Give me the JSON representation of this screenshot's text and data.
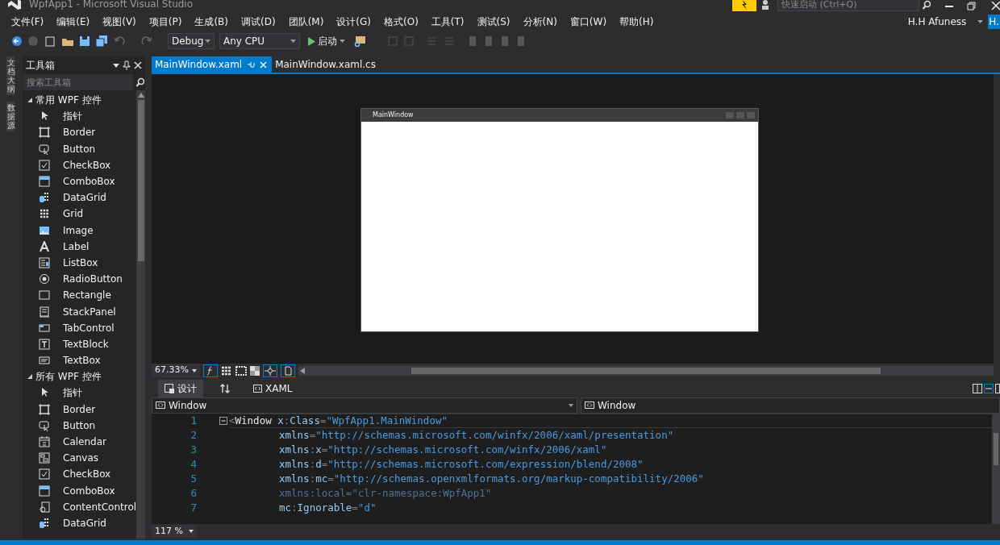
{
  "window": {
    "title": "WpfApp1 - Microsoft Visual Studio",
    "quick_launch": {
      "placeholder": "快速启动 (Ctrl+Q)"
    }
  },
  "menu": [
    "文件(F)",
    "编辑(E)",
    "视图(V)",
    "项目(P)",
    "生成(B)",
    "调试(D)",
    "团队(M)",
    "设计(G)",
    "格式(O)",
    "工具(T)",
    "测试(S)",
    "分析(N)",
    "窗口(W)",
    "帮助(H)"
  ],
  "account": {
    "user": "H.H Afuness",
    "badge": "H."
  },
  "toolbar": {
    "configuration": "Debug",
    "platform": "Any CPU",
    "start": "启动"
  },
  "side_tabs": [
    "文档大纲",
    "数据源"
  ],
  "toolbox": {
    "title": "工具箱",
    "search": {
      "placeholder": "搜索工具箱"
    },
    "groups": [
      {
        "label": "常用 WPF 控件",
        "expanded": true,
        "children": [
          {
            "label": "指针"
          },
          {
            "label": "Border"
          },
          {
            "label": "Button"
          },
          {
            "label": "CheckBox"
          },
          {
            "label": "ComboBox"
          },
          {
            "label": "DataGrid"
          },
          {
            "label": "Grid"
          },
          {
            "label": "Image"
          },
          {
            "label": "Label"
          },
          {
            "label": "ListBox"
          },
          {
            "label": "RadioButton"
          },
          {
            "label": "Rectangle"
          },
          {
            "label": "StackPanel"
          },
          {
            "label": "TabControl"
          },
          {
            "label": "TextBlock"
          },
          {
            "label": "TextBox"
          }
        ]
      },
      {
        "label": "所有 WPF 控件",
        "expanded": true,
        "children": [
          {
            "label": "指针"
          },
          {
            "label": "Border"
          },
          {
            "label": "Button"
          },
          {
            "label": "Calendar"
          },
          {
            "label": "Canvas"
          },
          {
            "label": "CheckBox"
          },
          {
            "label": "ComboBox"
          },
          {
            "label": "ContentControl"
          },
          {
            "label": "DataGrid"
          }
        ]
      }
    ]
  },
  "doc_tabs": [
    {
      "label": "MainWindow.xaml",
      "selected": true
    },
    {
      "label": "MainWindow.xaml.cs",
      "selected": false
    }
  ],
  "designer": {
    "preview_title": "MainWindow",
    "zoom": "67.33%"
  },
  "split_tabs": [
    {
      "label": "设计",
      "selected": true
    },
    {
      "label": "XAML",
      "selected": false
    }
  ],
  "nav": {
    "left": "Window",
    "right": "Window"
  },
  "code": [
    {
      "number": "1",
      "tokens": [
        {
          "kind": "punct",
          "text": "<"
        },
        {
          "kind": "element",
          "text": "Window"
        },
        {
          "kind": "attr",
          "text": " x"
        },
        {
          "kind": "punct",
          "text": ":"
        },
        {
          "kind": "attr",
          "text": "Class"
        },
        {
          "kind": "punct",
          "text": "="
        },
        {
          "kind": "value",
          "text": "\"WpfApp1.MainWindow\""
        }
      ]
    },
    {
      "number": "2",
      "tokens": [
        {
          "kind": "attr",
          "text": "xmlns"
        },
        {
          "kind": "punct",
          "text": "="
        },
        {
          "kind": "value",
          "text": "\"http://schemas.microsoft.com/winfx/2006/xaml/presentation\""
        }
      ]
    },
    {
      "number": "3",
      "tokens": [
        {
          "kind": "attr",
          "text": "xmlns"
        },
        {
          "kind": "punct",
          "text": ":"
        },
        {
          "kind": "attr",
          "text": "x"
        },
        {
          "kind": "punct",
          "text": "="
        },
        {
          "kind": "value",
          "text": "\"http://schemas.microsoft.com/winfx/2006/xaml\""
        }
      ]
    },
    {
      "number": "4",
      "tokens": [
        {
          "kind": "attr",
          "text": "xmlns"
        },
        {
          "kind": "punct",
          "text": ":"
        },
        {
          "kind": "attr",
          "text": "d"
        },
        {
          "kind": "punct",
          "text": "="
        },
        {
          "kind": "value",
          "text": "\"http://schemas.microsoft.com/expression/blend/2008\""
        }
      ]
    },
    {
      "number": "5",
      "tokens": [
        {
          "kind": "attr",
          "text": "xmlns"
        },
        {
          "kind": "punct",
          "text": ":"
        },
        {
          "kind": "attr",
          "text": "mc"
        },
        {
          "kind": "punct",
          "text": "="
        },
        {
          "kind": "value",
          "text": "\"http://schemas.openxmlformats.org/markup-compatibility/2006\""
        }
      ]
    },
    {
      "number": "6",
      "tokens": [
        {
          "kind": "dim",
          "text": "xmlns:local=\"clr-namespace:WpfApp1\""
        }
      ]
    },
    {
      "number": "7",
      "tokens": [
        {
          "kind": "attr",
          "text": "mc"
        },
        {
          "kind": "punct",
          "text": ":"
        },
        {
          "kind": "attr",
          "text": "Ignorable"
        },
        {
          "kind": "punct",
          "text": "="
        },
        {
          "kind": "value",
          "text": "\"d\""
        }
      ]
    }
  ],
  "editor_zoom": "117 %"
}
